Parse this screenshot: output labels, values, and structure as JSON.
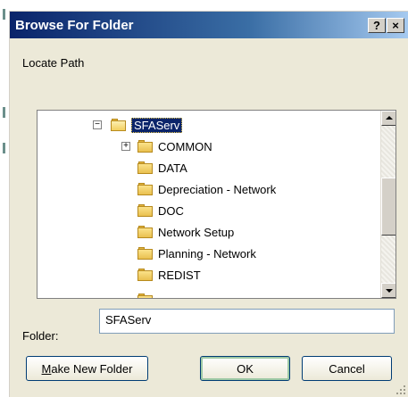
{
  "window": {
    "title": "Browse For Folder",
    "help_glyph": "?",
    "close_glyph": "×"
  },
  "instruction": "Locate Path",
  "tree": {
    "root": {
      "label": "SFAServ",
      "expander": "−",
      "selected": true
    },
    "children": [
      {
        "label": "COMMON",
        "expander": "+"
      },
      {
        "label": "DATA"
      },
      {
        "label": "Depreciation - Network"
      },
      {
        "label": "DOC"
      },
      {
        "label": "Network Setup"
      },
      {
        "label": "Planning - Network"
      },
      {
        "label": "REDIST"
      }
    ]
  },
  "folder_field": {
    "label": "Folder:",
    "value": "SFAServ"
  },
  "buttons": {
    "make_new_folder_mnemonic": "M",
    "make_new_folder_rest": "ake New Folder",
    "ok": "OK",
    "cancel": "Cancel"
  },
  "colors": {
    "titlebar_start": "#0a246a",
    "titlebar_end": "#a6caf0",
    "dialog_bg": "#ece9d8",
    "selection": "#0a246a"
  },
  "icons": {
    "folder": "folder-icon",
    "folder_open": "folder-open-icon",
    "expand": "plus-box-icon",
    "collapse": "minus-box-icon"
  }
}
